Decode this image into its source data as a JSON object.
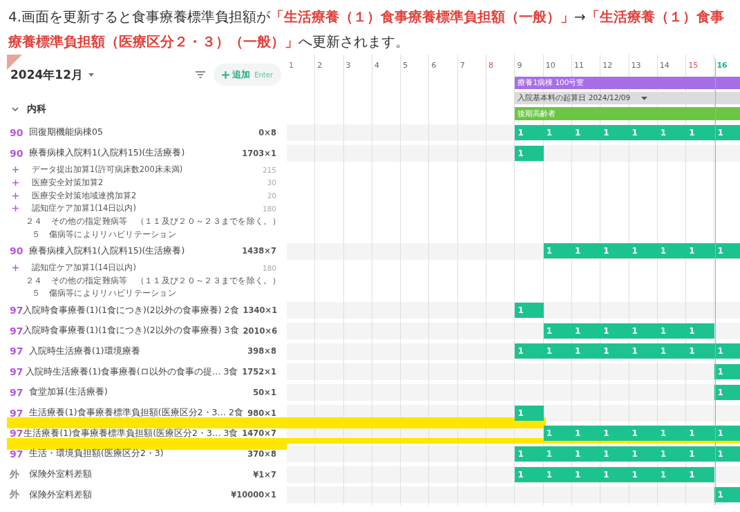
{
  "caption": "4.画面を更新すると食事療養標準負担額が**「生活療養（１）食事療養標準負担額（一般）」**→**「生活療養（１）食事療養標準負担額（医療区分２・３）（一般）」**へ更新されます。",
  "header": {
    "month": "2024年12月",
    "add_button": {
      "label": "追加",
      "shortcut": "Enter"
    }
  },
  "days": [
    {
      "label": "1",
      "kind": "sunday"
    },
    {
      "label": "2",
      "kind": "weekday"
    },
    {
      "label": "3",
      "kind": "weekday"
    },
    {
      "label": "4",
      "kind": "weekday"
    },
    {
      "label": "5",
      "kind": "weekday"
    },
    {
      "label": "6",
      "kind": "weekday"
    },
    {
      "label": "7",
      "kind": "weekday"
    },
    {
      "label": "8",
      "kind": "sunday"
    },
    {
      "label": "9",
      "kind": "weekday"
    },
    {
      "label": "10",
      "kind": "weekday"
    },
    {
      "label": "11",
      "kind": "weekday"
    },
    {
      "label": "12",
      "kind": "weekday"
    },
    {
      "label": "13",
      "kind": "weekday"
    },
    {
      "label": "14",
      "kind": "weekday"
    },
    {
      "label": "15",
      "kind": "sunday"
    },
    {
      "label": "16",
      "kind": "today"
    }
  ],
  "banners": [
    {
      "text": "療養1病棟 100号室",
      "color": "#a66fe6",
      "dropdown": false
    },
    {
      "text": "入院基本料の起算日 2024/12/09",
      "color": "#dcdcdc",
      "dropdown": true
    },
    {
      "text": "後期高齢者",
      "color": "#6cc644",
      "dropdown": false
    }
  ],
  "group": {
    "name": "内科",
    "expanded": true
  },
  "rows": [
    {
      "code": "90",
      "kind": "insured",
      "name": "回復期機能病棟05",
      "amount": "0×8",
      "highlighted": false,
      "cells": [
        null,
        null,
        null,
        null,
        null,
        null,
        null,
        null,
        "1",
        "1",
        "1",
        "1",
        "1",
        "1",
        "1",
        "1"
      ],
      "subs": []
    },
    {
      "code": "90",
      "kind": "insured",
      "name": "療養病棟入院料1(入院料15)(生活療養)",
      "amount": "1703×1",
      "highlighted": false,
      "cells": [
        null,
        null,
        null,
        null,
        null,
        null,
        null,
        null,
        "1",
        null,
        null,
        null,
        null,
        null,
        null,
        null
      ],
      "subs": [
        {
          "kind": "addition",
          "text": "データ提出加算1(許可病床数200床未満)",
          "value": "215"
        },
        {
          "kind": "addition",
          "text": "医療安全対策加算2",
          "value": "30"
        },
        {
          "kind": "addition",
          "text": "医療安全対策地域連携加算2",
          "value": "20"
        },
        {
          "kind": "addition",
          "text": "認知症ケア加算1(14日以内)",
          "value": "180"
        },
        {
          "kind": "note",
          "text": "２４　その他の指定難病等　（１１及び２０～２３までを除く。）"
        },
        {
          "kind": "note",
          "text": "５　傷病等によりリハビリテーション"
        }
      ]
    },
    {
      "code": "90",
      "kind": "insured",
      "name": "療養病棟入院料1(入院料15)(生活療養)",
      "amount": "1438×7",
      "highlighted": false,
      "cells": [
        null,
        null,
        null,
        null,
        null,
        null,
        null,
        null,
        null,
        "1",
        "1",
        "1",
        "1",
        "1",
        "1",
        "1"
      ],
      "subs": [
        {
          "kind": "addition",
          "text": "認知症ケア加算1(14日以内)",
          "value": "180"
        },
        {
          "kind": "note",
          "text": "２４　その他の指定難病等　（１１及び２０～２３までを除く。）"
        },
        {
          "kind": "note",
          "text": "５　傷病等によりリハビリテーション"
        }
      ]
    },
    {
      "code": "97",
      "kind": "insured",
      "name": "入院時食事療養(1)(1食につき)(2以外の食事療養) 2食",
      "amount": "1340×1",
      "highlighted": false,
      "cells": [
        null,
        null,
        null,
        null,
        null,
        null,
        null,
        null,
        "1",
        null,
        null,
        null,
        null,
        null,
        null,
        null
      ],
      "subs": []
    },
    {
      "code": "97",
      "kind": "insured",
      "name": "入院時食事療養(1)(1食につき)(2以外の食事療養) 3食",
      "amount": "2010×6",
      "highlighted": false,
      "cells": [
        null,
        null,
        null,
        null,
        null,
        null,
        null,
        null,
        null,
        "1",
        "1",
        "1",
        "1",
        "1",
        "1",
        null
      ],
      "subs": []
    },
    {
      "code": "97",
      "kind": "insured",
      "name": "入院時生活療養(1)環境療養",
      "amount": "398×8",
      "highlighted": false,
      "cells": [
        null,
        null,
        null,
        null,
        null,
        null,
        null,
        null,
        "1",
        "1",
        "1",
        "1",
        "1",
        "1",
        "1",
        "1"
      ],
      "subs": []
    },
    {
      "code": "97",
      "kind": "insured",
      "name": "入院時生活療養(1)食事療養(ロ以外の食事の提…  3食",
      "amount": "1752×1",
      "highlighted": false,
      "cells": [
        null,
        null,
        null,
        null,
        null,
        null,
        null,
        null,
        null,
        null,
        null,
        null,
        null,
        null,
        null,
        "1"
      ],
      "subs": []
    },
    {
      "code": "97",
      "kind": "insured",
      "name": "食堂加算(生活療養)",
      "amount": "50×1",
      "highlighted": false,
      "cells": [
        null,
        null,
        null,
        null,
        null,
        null,
        null,
        null,
        null,
        null,
        null,
        null,
        null,
        null,
        null,
        "1"
      ],
      "subs": []
    },
    {
      "code": "97",
      "kind": "insured",
      "name": "生活療養(1)食事療養標準負担額(医療区分2・3…  2食",
      "amount": "980×1",
      "highlighted": false,
      "cells": [
        null,
        null,
        null,
        null,
        null,
        null,
        null,
        null,
        "1",
        null,
        null,
        null,
        null,
        null,
        null,
        null
      ],
      "subs": []
    },
    {
      "code": "97",
      "kind": "insured",
      "name": "生活療養(1)食事療養標準負担額(医療区分2・3…  3食",
      "amount": "1470×7",
      "highlighted": true,
      "cells": [
        null,
        null,
        null,
        null,
        null,
        null,
        null,
        null,
        null,
        "1",
        "1",
        "1",
        "1",
        "1",
        "1",
        "1"
      ],
      "subs": []
    },
    {
      "code": "97",
      "kind": "insured",
      "name": "生活・環境負担額(医療区分2・3)",
      "amount": "370×8",
      "highlighted": false,
      "cells": [
        null,
        null,
        null,
        null,
        null,
        null,
        null,
        null,
        "1",
        "1",
        "1",
        "1",
        "1",
        "1",
        "1",
        "1"
      ],
      "subs": []
    },
    {
      "code": "外",
      "kind": "uninsured",
      "name": "保険外室料差額",
      "amount": "¥1×7",
      "highlighted": false,
      "cells": [
        null,
        null,
        null,
        null,
        null,
        null,
        null,
        null,
        "1",
        "1",
        "1",
        "1",
        "1",
        "1",
        "1",
        null
      ],
      "subs": []
    },
    {
      "code": "外",
      "kind": "uninsured",
      "name": "保険外室料差額",
      "amount": "¥10000×1",
      "highlighted": false,
      "cells": [
        null,
        null,
        null,
        null,
        null,
        null,
        null,
        null,
        null,
        null,
        null,
        null,
        null,
        null,
        null,
        "1"
      ],
      "subs": []
    }
  ]
}
